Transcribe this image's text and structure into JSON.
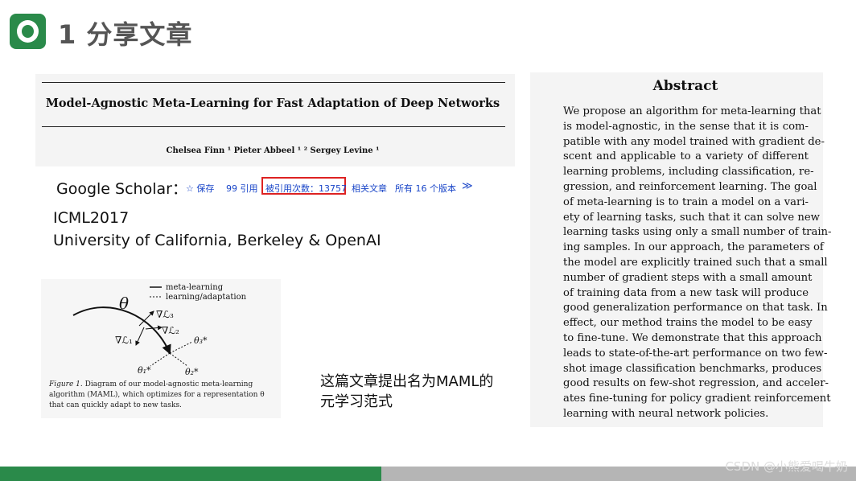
{
  "slide": {
    "title": "1 分享文章"
  },
  "paper": {
    "title": "Model-Agnostic Meta-Learning for Fast Adaptation of Deep Networks",
    "authors": "Chelsea Finn ¹   Pieter Abbeel ¹ ²   Sergey Levine ¹"
  },
  "scholar": {
    "label": "Google Scholar：",
    "save": "☆ 保存",
    "cite": "99 引用",
    "cited_by": "被引用次数：13757",
    "related": "相关文章",
    "versions": "所有 16 个版本",
    "more": "≫"
  },
  "venue": {
    "conference": "ICML2017",
    "affiliation": "University of California, Berkeley  & OpenAI"
  },
  "figure": {
    "legend_meta": "meta-learning",
    "legend_adapt": "learning/adaptation",
    "theta": "θ",
    "grad_l3": "∇ℒ₃",
    "grad_l2": "∇ℒ₂",
    "grad_l1": "∇ℒ₁",
    "theta1": "θ₁*",
    "theta2": "θ₂*",
    "theta3": "θ₃*",
    "caption_label": "Figure 1.",
    "caption_text": " Diagram of our model-agnostic meta-learning algorithm (MAML), which optimizes for a representation θ that can quickly adapt to new tasks."
  },
  "note": "这篇文章提出名为MAML的元学习范式",
  "abstract": {
    "heading": "Abstract",
    "lines": [
      "We propose an algorithm for meta-learning that",
      "is model-agnostic, in the sense that it is com-",
      "patible with any model trained with gradient de-",
      "scent and applicable to a variety of different",
      "learning problems, including classification, re-",
      "gression, and reinforcement learning. The goal",
      "of meta-learning is to train a model on a vari-",
      "ety of learning tasks, such that it can solve new",
      "learning tasks using only a small number of train-",
      "ing samples. In our approach, the parameters of",
      "the model are explicitly trained such that a small",
      "number of gradient steps with a small amount",
      "of training data from a new task will produce",
      "good generalization performance on that task. In",
      "effect, our method trains the model to be easy",
      "to fine-tune. We demonstrate that this approach",
      "leads to state-of-the-art performance on two few-",
      "shot image classification benchmarks, produces",
      "good results on few-shot regression, and acceler-",
      "ates fine-tuning for policy gradient reinforcement",
      "learning with neural network policies."
    ]
  },
  "watermark": "CSDN @小熊爱喝牛奶",
  "colors": {
    "accent_green": "#2a8a4a",
    "cited_box_red": "#dd2222",
    "link_blue": "#1a46c8"
  }
}
